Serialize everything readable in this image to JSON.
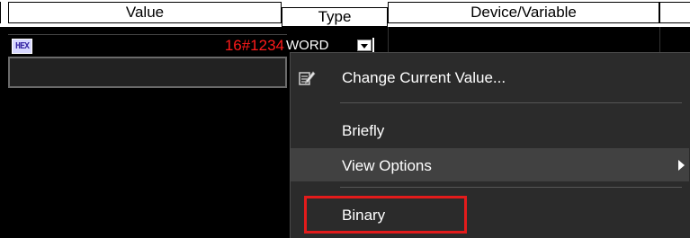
{
  "table": {
    "headers": {
      "value": "Value",
      "type": "Type",
      "device": "Device/Variable"
    },
    "row": {
      "format_icon": "HEX",
      "value": "16#1234",
      "type": "WORD"
    }
  },
  "context_menu": {
    "items": [
      {
        "label": "Change Current Value...",
        "icon": "edit-value-icon"
      },
      {
        "label": "Briefly"
      },
      {
        "label": "View Options",
        "has_submenu": true,
        "highlighted": true
      },
      {
        "label": "Binary",
        "annotated": true
      }
    ]
  },
  "colors": {
    "value_text": "#ff1a1a",
    "menu_bg": "#2b2b2b",
    "menu_hover": "#414141",
    "annotation_box": "#e31b1b"
  }
}
